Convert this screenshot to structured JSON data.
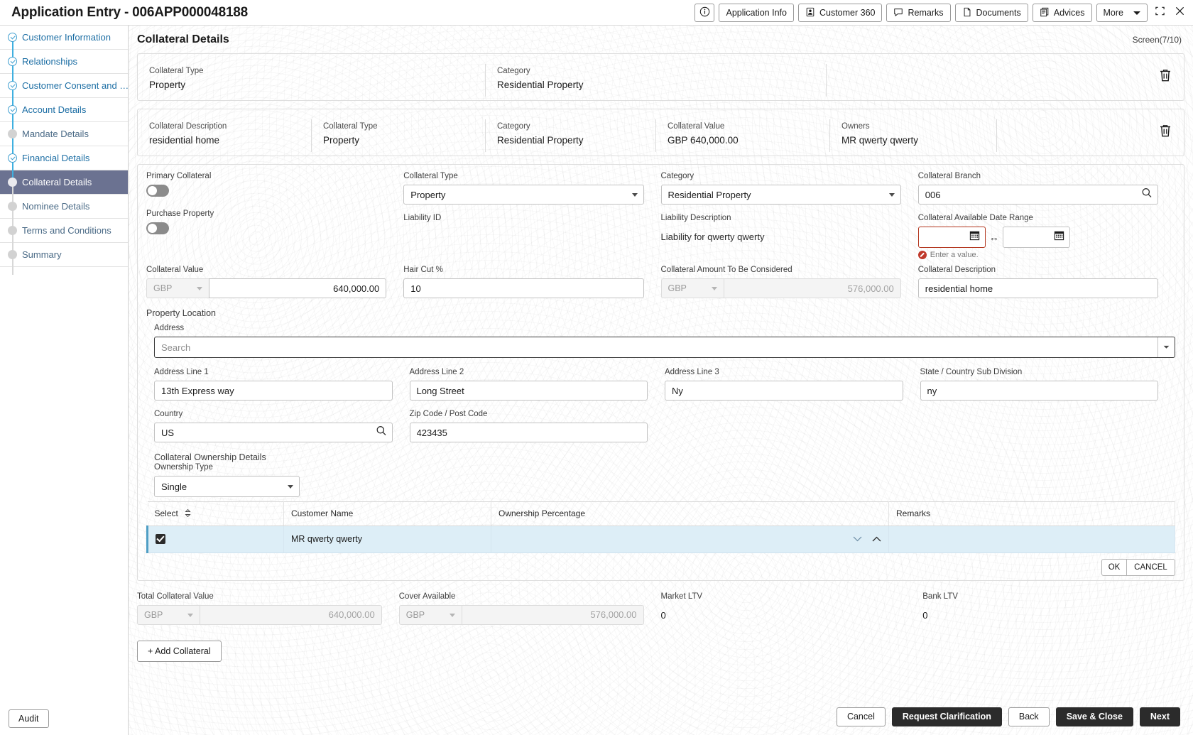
{
  "header": {
    "title": "Application Entry - 006APP000048188",
    "actions": [
      {
        "label": "",
        "icon": "info-icon",
        "icon_only": true
      },
      {
        "label": "Application Info",
        "icon": ""
      },
      {
        "label": "Customer 360",
        "icon": "person-badge-icon"
      },
      {
        "label": "Remarks",
        "icon": "comment-icon"
      },
      {
        "label": "Documents",
        "icon": "document-icon"
      },
      {
        "label": "Advices",
        "icon": "advices-icon"
      },
      {
        "label": "More",
        "icon": "chevron-down-icon"
      }
    ],
    "minimize_icon": "collapse-icon",
    "close_icon": "close-icon"
  },
  "sidebar": {
    "items": [
      {
        "label": "Customer Information",
        "state": "done"
      },
      {
        "label": "Relationships",
        "state": "done"
      },
      {
        "label": "Customer Consent and  …",
        "state": "done"
      },
      {
        "label": "Account Details",
        "state": "done"
      },
      {
        "label": "Mandate Details",
        "state": "todo"
      },
      {
        "label": "Financial Details",
        "state": "done"
      },
      {
        "label": "Collateral Details",
        "state": "active"
      },
      {
        "label": "Nominee Details",
        "state": "todo"
      },
      {
        "label": "Terms and Conditions",
        "state": "todo"
      },
      {
        "label": "Summary",
        "state": "todo"
      }
    ],
    "audit_label": "Audit"
  },
  "main": {
    "page_title": "Collateral Details",
    "screen_count": "Screen(7/10)"
  },
  "summary_card": {
    "collateral_type_label": "Collateral Type",
    "collateral_type_value": "Property",
    "category_label": "Category",
    "category_value": "Residential Property",
    "delete_icon": "trash-icon"
  },
  "detail_card": {
    "description_label": "Collateral Description",
    "description_value": "residential home",
    "type_label": "Collateral Type",
    "type_value": "Property",
    "category_label": "Category",
    "category_value": "Residential Property",
    "value_label": "Collateral Value",
    "value_value": "GBP 640,000.00",
    "owners_label": "Owners",
    "owners_value": "MR qwerty qwerty",
    "delete_icon": "trash-icon"
  },
  "form": {
    "primary_collateral_label": "Primary Collateral",
    "primary_collateral_on": false,
    "purchase_property_label": "Purchase Property",
    "purchase_property_on": false,
    "collateral_type_label": "Collateral Type",
    "collateral_type_value": "Property",
    "liability_id_label": "Liability ID",
    "liability_id_value": "",
    "category_label": "Category",
    "category_value": "Residential Property",
    "liability_description_label": "Liability Description",
    "liability_description_value": "Liability for qwerty qwerty",
    "collateral_branch_label": "Collateral Branch",
    "collateral_branch_value": "006",
    "date_range_label": "Collateral Available Date Range",
    "date_from_value": "",
    "date_to_value": "",
    "date_error": "Enter a value.",
    "collateral_value_label": "Collateral Value",
    "collateral_value_ccy": "GBP",
    "collateral_value_amount": "640,000.00",
    "hair_cut_label": "Hair Cut %",
    "hair_cut_value": "10",
    "amount_considered_label": "Collateral Amount To Be Considered",
    "amount_considered_ccy": "GBP",
    "amount_considered_value": "576,000.00",
    "collateral_description_label": "Collateral Description",
    "collateral_description_value": "residential home",
    "property_location_label": "Property Location",
    "address_label": "Address",
    "address_placeholder": "Search",
    "address_line1_label": "Address Line 1",
    "address_line1_value": "13th Express way",
    "address_line2_label": "Address Line 2",
    "address_line2_value": "Long Street",
    "address_line3_label": "Address Line 3",
    "address_line3_value": "Ny",
    "state_label": "State / Country Sub Division",
    "state_value": "ny",
    "country_label": "Country",
    "country_value": "US",
    "zip_label": "Zip Code / Post Code",
    "zip_value": "423435",
    "ownership_section_label": "Collateral Ownership Details",
    "ownership_type_label": "Ownership Type",
    "ownership_type_value": "Single"
  },
  "ownership_table": {
    "columns": [
      "Select",
      "Customer Name",
      "Ownership Percentage",
      "Remarks"
    ],
    "rows": [
      {
        "selected": true,
        "customer_name": "MR qwerty qwerty",
        "ownership_percentage": "",
        "remarks": ""
      }
    ],
    "ok_label": "OK",
    "cancel_label": "CANCEL"
  },
  "totals": {
    "total_collateral_value_label": "Total Collateral Value",
    "total_collateral_value_ccy": "GBP",
    "total_collateral_value_amount": "640,000.00",
    "cover_available_label": "Cover Available",
    "cover_available_ccy": "GBP",
    "cover_available_amount": "576,000.00",
    "market_ltv_label": "Market LTV",
    "market_ltv_value": "0",
    "bank_ltv_label": "Bank LTV",
    "bank_ltv_value": "0",
    "add_collateral_label": "+ Add Collateral"
  },
  "footer": {
    "cancel": "Cancel",
    "request_clarification": "Request Clarification",
    "back": "Back",
    "save_close": "Save & Close",
    "next": "Next"
  },
  "colors": {
    "active_nav": "#6b7291",
    "link": "#1c6ea4",
    "check": "#3fb0e0",
    "error": "#b3361e",
    "row_selected": "#ddeef7",
    "dark_button": "#2b2b2b"
  }
}
